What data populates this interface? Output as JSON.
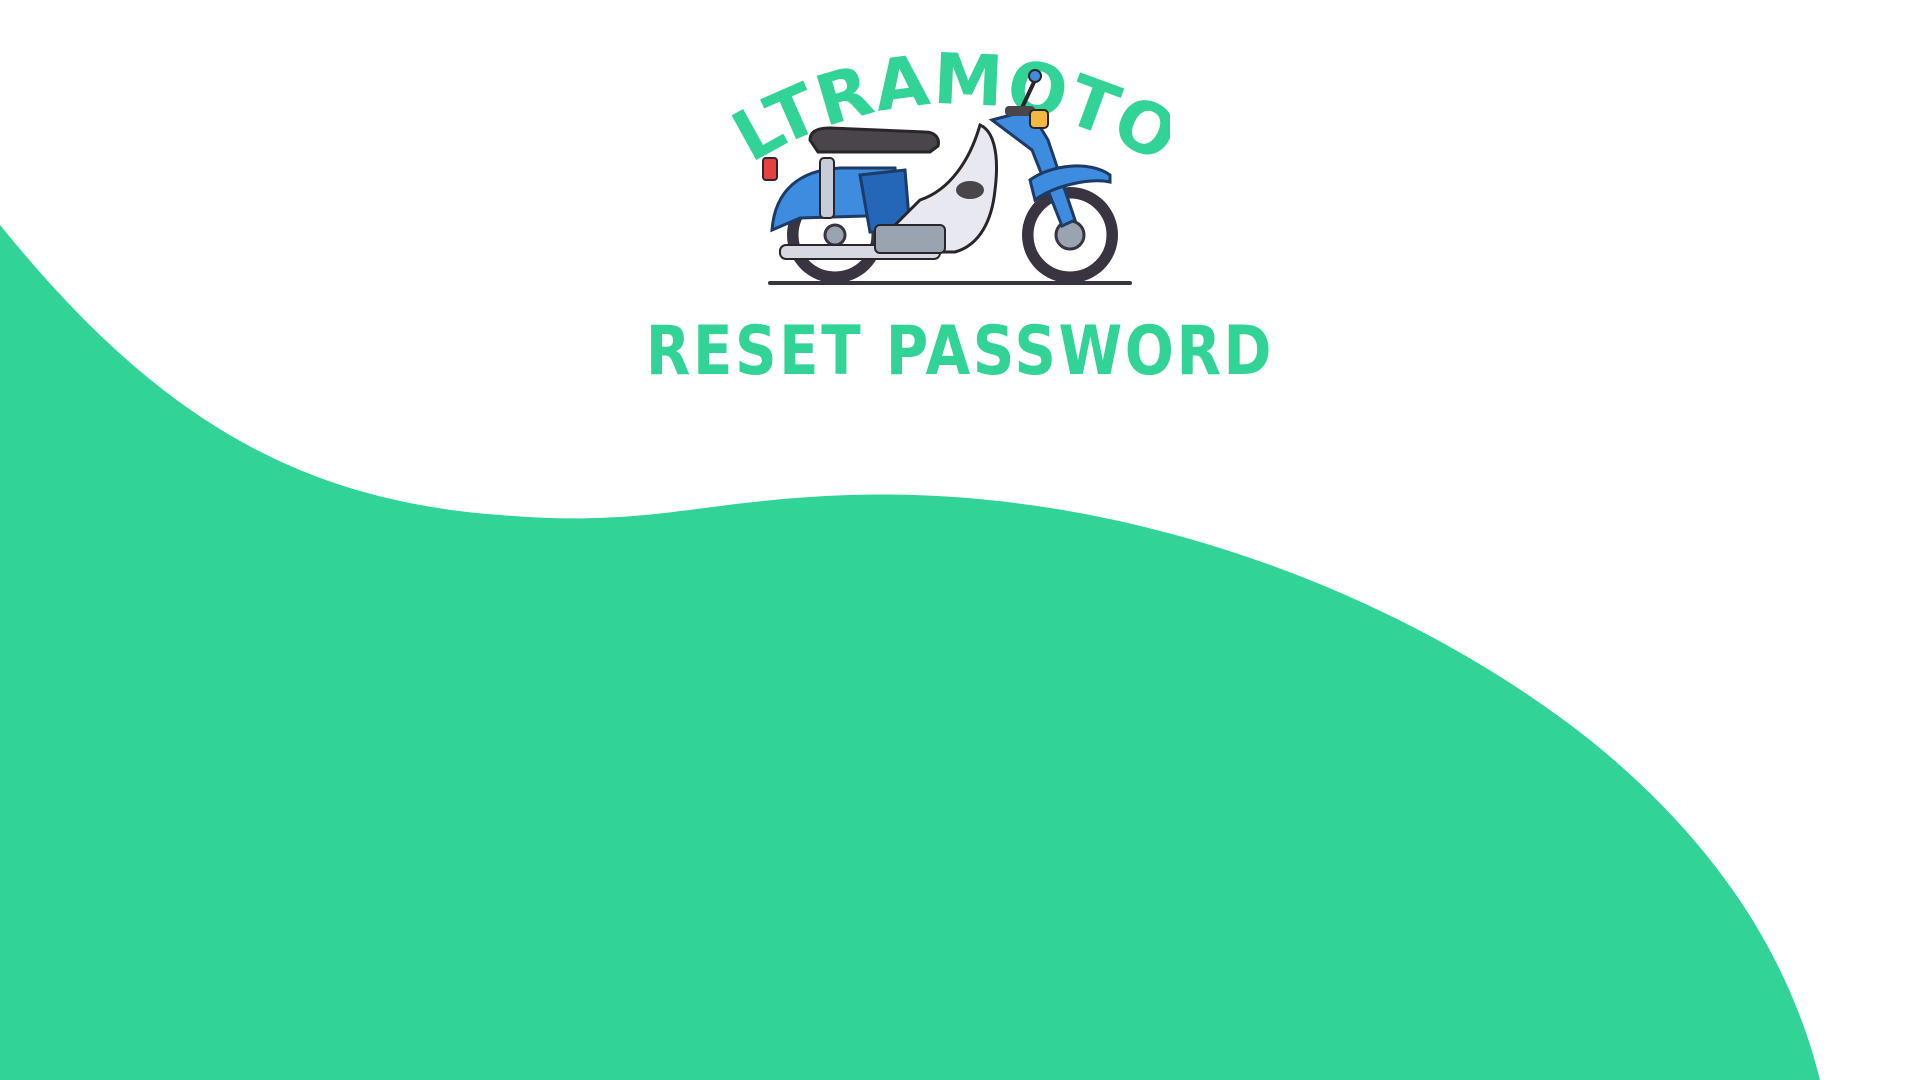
{
  "brand": {
    "logo_text": "ULTRAMOTOR"
  },
  "page": {
    "title": "RESET PASSWORD"
  },
  "colors": {
    "accent": "#31D396",
    "background": "#ffffff",
    "bike_body": "#3E8CE0",
    "bike_body_dark": "#2467B8",
    "bike_panel": "#E8E8F0",
    "tire": "#3A3440",
    "seat": "#4A454A"
  },
  "icons": {
    "logo": "motorcycle-icon"
  }
}
